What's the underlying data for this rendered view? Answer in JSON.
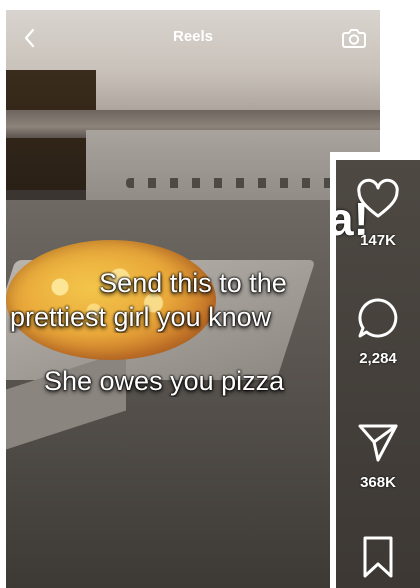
{
  "header": {
    "title": "Reels"
  },
  "caption": {
    "line1": "Send this to the",
    "line2": "prettiest girl you know",
    "line3": "She owes you pizza"
  },
  "side_panel": {
    "overlay_text": "a!",
    "likes": "147K",
    "comments": "2,284",
    "shares": "368K"
  },
  "icons": {
    "back": "chevron-left-icon",
    "camera": "camera-icon",
    "like": "heart-icon",
    "comment": "comment-bubble-icon",
    "share": "paper-plane-icon",
    "save": "bookmark-icon"
  },
  "colors": {
    "icon": "#ffffff",
    "background": "#ffffff"
  }
}
